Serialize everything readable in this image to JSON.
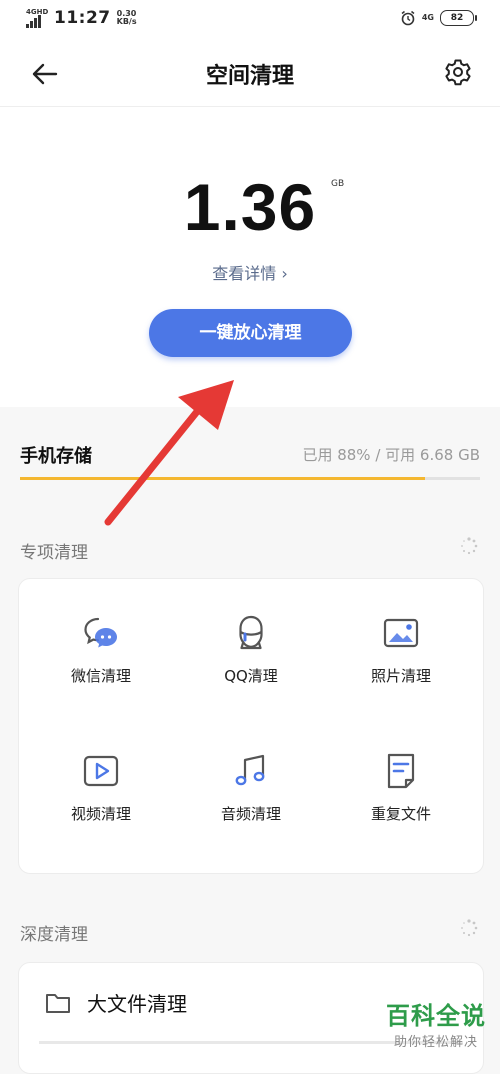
{
  "status_bar": {
    "network": "4GHD",
    "time": "11:27",
    "speed_value": "0.30",
    "speed_unit": "KB/s",
    "right_network": "4G",
    "battery": "82"
  },
  "header": {
    "title": "空间清理",
    "back_icon": "back-arrow-icon",
    "settings_icon": "gear-icon"
  },
  "summary": {
    "value": "1.36",
    "unit": "GB",
    "details_label": "查看详情 ›",
    "clean_button": "一键放心清理"
  },
  "storage": {
    "label": "手机存储",
    "stats": "已用 88% / 可用 6.68 GB",
    "used_fraction": 0.88,
    "bar_color": "#f4b730"
  },
  "special": {
    "title": "专项清理",
    "items": [
      {
        "label": "微信清理",
        "icon": "wechat-icon"
      },
      {
        "label": "QQ清理",
        "icon": "qq-icon"
      },
      {
        "label": "照片清理",
        "icon": "photo-icon"
      },
      {
        "label": "视频清理",
        "icon": "video-icon"
      },
      {
        "label": "音频清理",
        "icon": "music-icon"
      },
      {
        "label": "重复文件",
        "icon": "document-icon"
      }
    ]
  },
  "deep": {
    "title": "深度清理",
    "item_label": "大文件清理",
    "item_icon": "folder-icon"
  },
  "watermark": {
    "main": "百科全说",
    "sub": "助你轻松解决"
  },
  "colors": {
    "accent": "#4c77e6",
    "annotation_arrow": "#e53935"
  }
}
